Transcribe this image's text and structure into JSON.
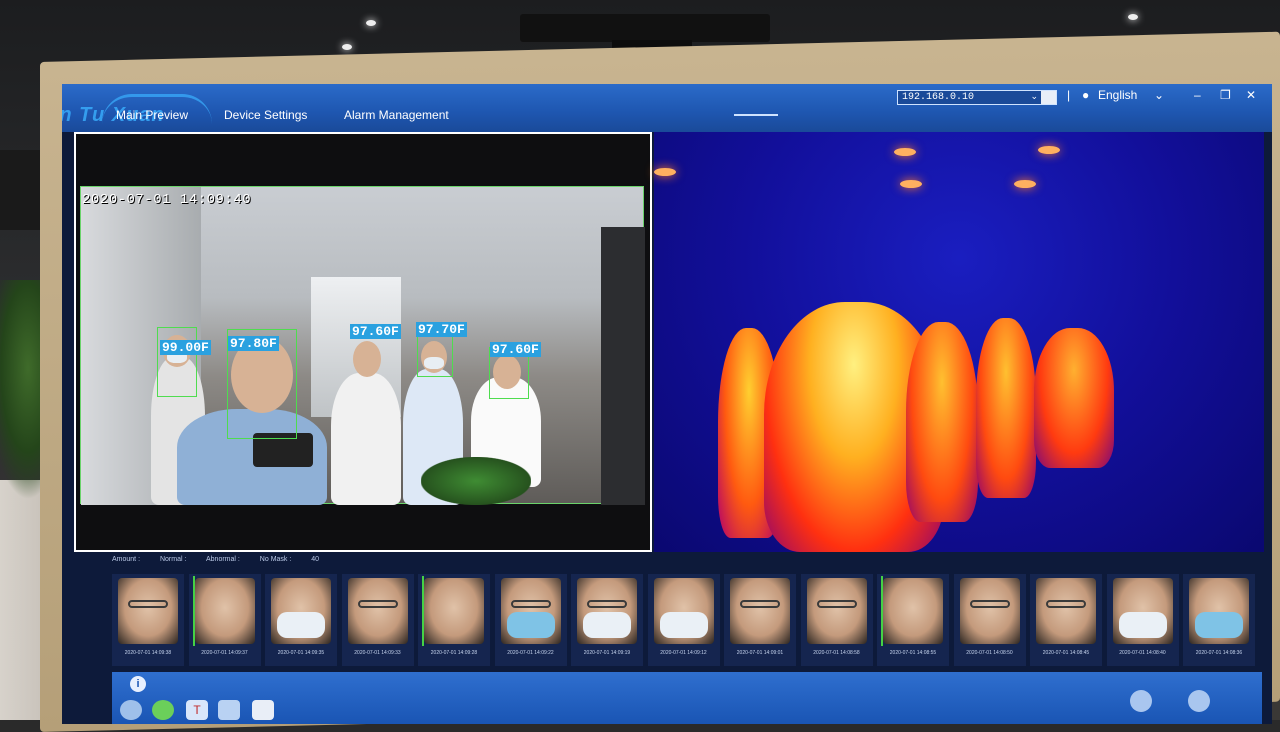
{
  "window": {
    "brand": "Lan Tu Xuan",
    "nav": [
      "Main Preview",
      "Device Settings",
      "Alarm Management"
    ],
    "ip_value": "192.168.0.10",
    "language": "English",
    "controls": [
      "chevron-down",
      "minimize",
      "restore",
      "close"
    ]
  },
  "rgb_feed": {
    "timestamp": "2020-07-01 14:09:40",
    "temps": [
      "99.00F",
      "97.80F",
      "97.60F",
      "97.70F",
      "97.60F"
    ]
  },
  "stats": {
    "amount_label": "Amount :",
    "normal_label": "Normal :",
    "abnormal_label": "Abnormal :",
    "no_mask_label": "No Mask :",
    "no_mask_value": "40"
  },
  "thumbnails": [
    {
      "time": "2020-07-01 14:09:38",
      "mask": "none",
      "glasses": true
    },
    {
      "time": "2020-07-01 14:09:37",
      "mask": "none",
      "glasses": false
    },
    {
      "time": "2020-07-01 14:09:35",
      "mask": "white",
      "glasses": false
    },
    {
      "time": "2020-07-01 14:09:33",
      "mask": "none",
      "glasses": true
    },
    {
      "time": "2020-07-01 14:09:28",
      "mask": "none",
      "glasses": false
    },
    {
      "time": "2020-07-01 14:09:22",
      "mask": "blue",
      "glasses": true
    },
    {
      "time": "2020-07-01 14:09:19",
      "mask": "white",
      "glasses": true
    },
    {
      "time": "2020-07-01 14:09:12",
      "mask": "white",
      "glasses": false
    },
    {
      "time": "2020-07-01 14:09:01",
      "mask": "none",
      "glasses": true
    },
    {
      "time": "2020-07-01 14:08:58",
      "mask": "none",
      "glasses": true
    },
    {
      "time": "2020-07-01 14:08:55",
      "mask": "none",
      "glasses": false
    },
    {
      "time": "2020-07-01 14:08:50",
      "mask": "none",
      "glasses": true
    },
    {
      "time": "2020-07-01 14:08:45",
      "mask": "none",
      "glasses": true
    },
    {
      "time": "2020-07-01 14:08:40",
      "mask": "white",
      "glasses": false
    },
    {
      "time": "2020-07-01 14:08:36",
      "mask": "blue",
      "glasses": false
    }
  ],
  "taskbar": {
    "info_glyph": "i",
    "app_glyph": "T"
  },
  "colors": {
    "titlebar": "#1e56b0",
    "temp_tag": "#2aa1e0",
    "face_box": "#4fdc4f"
  }
}
